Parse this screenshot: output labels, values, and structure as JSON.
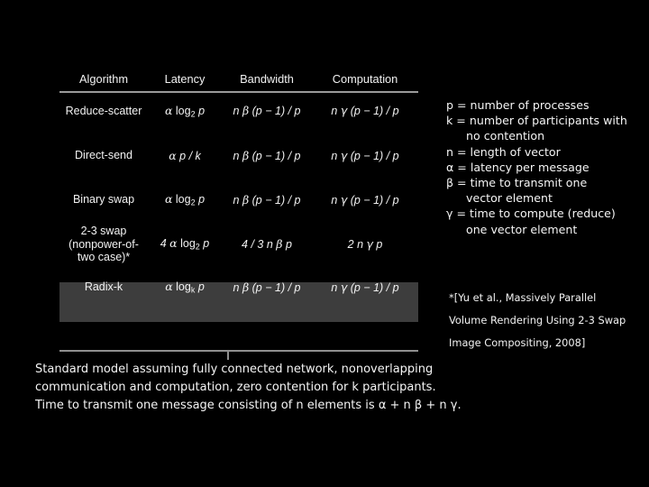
{
  "slide": {
    "background": "#000000",
    "highlight_color": "#3d3d3d",
    "rule_color": "#9a9a9a",
    "text_color": "#f2f2f2"
  },
  "table": {
    "columns": [
      "Algorithm",
      "Latency",
      "Bandwidth",
      "Computation"
    ],
    "rows": [
      {
        "algorithm": "Reduce-scatter",
        "algorithm_lines": [
          "Reduce-scatter"
        ],
        "latency": "α log2 p",
        "bandwidth": "n β (p − 1) / p",
        "computation": "n γ (p − 1) / p",
        "highlighted": false
      },
      {
        "algorithm": "Direct-send",
        "algorithm_lines": [
          "Direct-send"
        ],
        "latency": "α p / k",
        "bandwidth": "n β (p − 1) / p",
        "computation": "n γ (p − 1) / p",
        "highlighted": false
      },
      {
        "algorithm": "Binary swap",
        "algorithm_lines": [
          "Binary swap"
        ],
        "latency": "α log2 p",
        "bandwidth": "n β (p − 1) / p",
        "computation": "n γ (p − 1) / p",
        "highlighted": false
      },
      {
        "algorithm": "2-3 swap (nonpower-of-two case)*",
        "algorithm_lines": [
          "2-3 swap",
          "(nonpower-of-",
          "two case)*"
        ],
        "latency": "4 α log2 p",
        "bandwidth": "4 / 3 n β p",
        "computation": "2 n γ p",
        "highlighted": false
      },
      {
        "algorithm": "Radix-k",
        "algorithm_lines": [
          "Radix-k"
        ],
        "latency": "α logk p",
        "bandwidth": "n β (p − 1) / p",
        "computation": "n γ (p − 1) / p",
        "highlighted": true
      }
    ],
    "cells": {
      "r0_alg": "Reduce-scatter",
      "r1_alg": "Direct-send",
      "r2_alg": "Binary swap",
      "r3_alg_l1": "2-3 swap",
      "r3_alg_l2": "(nonpower-of-",
      "r3_alg_l3": "two case)*",
      "r4_alg": "Radix-k",
      "log_base_2": "2",
      "log_base_k": "k",
      "lat_log_pre": "α log",
      "lat_log_post": " p",
      "lat_direct_send": "α p / k",
      "lat_23swap_pre": "4 α log",
      "bw_standard": "n β (p − 1) / p",
      "comp_standard": "n γ (p − 1) / p",
      "bw_23swap": "4 / 3 n β p",
      "comp_23swap": "2 n γ p"
    }
  },
  "legend": {
    "lines": [
      "p = number of processes",
      "k = number of participants with",
      "no contention",
      "n = length of vector",
      "α = latency per message",
      "β = time to transmit one",
      "vector element",
      "γ = time to compute (reduce)",
      "one vector element"
    ]
  },
  "citation": {
    "lines": [
      "*[Yu et al., Massively Parallel",
      "Volume Rendering Using 2-3 Swap",
      "Image Compositing, 2008]"
    ]
  },
  "caption": {
    "lines": [
      "Standard model assuming fully connected network, nonoverlapping",
      "communication and computation, zero contention for k participants.",
      "Time to transmit one message consisting of n elements is α + n β +  n γ."
    ]
  }
}
